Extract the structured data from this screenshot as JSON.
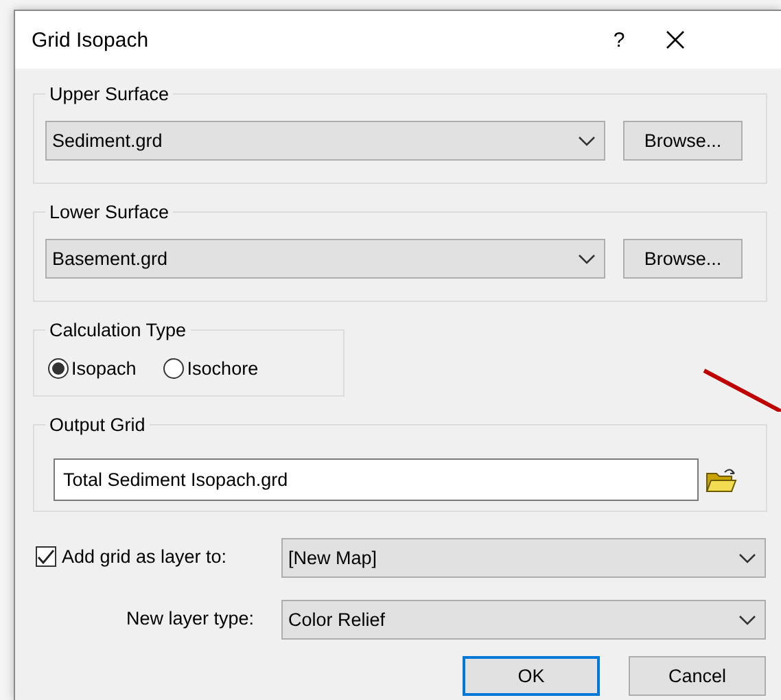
{
  "window": {
    "title": "Grid Isopach",
    "help_button": "?"
  },
  "upper_surface": {
    "label": "Upper Surface",
    "value": "Sediment.grd",
    "button": "Browse..."
  },
  "lower_surface": {
    "label": "Lower Surface",
    "value": "Basement.grd",
    "button": "Browse..."
  },
  "calculation_type": {
    "label": "Calculation Type",
    "options": [
      {
        "label": "Isopach",
        "selected": true
      },
      {
        "label": "Isochore",
        "selected": false
      }
    ]
  },
  "output_grid": {
    "label": "Output Grid",
    "value": "Total Sediment Isopach.grd"
  },
  "add_layer": {
    "label": "Add grid as layer to:",
    "checked": true,
    "value": "[New Map]"
  },
  "layer_type": {
    "label": "New layer type:",
    "value": "Color Relief"
  },
  "buttons": [
    {
      "label": "OK",
      "default": true
    },
    {
      "label": "Cancel",
      "default": false
    }
  ]
}
